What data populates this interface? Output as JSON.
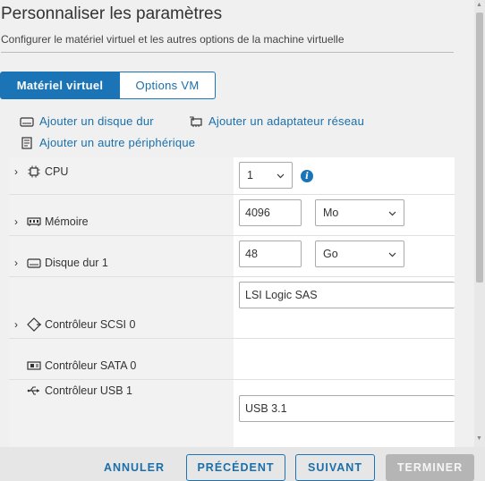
{
  "header": {
    "title": "Personnaliser les paramètres",
    "subtitle": "Configurer le matériel virtuel et les autres options de la machine virtuelle"
  },
  "tabs": [
    {
      "label": "Matériel virtuel",
      "active": true
    },
    {
      "label": "Options VM",
      "active": false
    }
  ],
  "actions": {
    "add_disk": "Ajouter un disque dur",
    "add_network": "Ajouter un adaptateur réseau",
    "add_device": "Ajouter un autre périphérique"
  },
  "hardware": {
    "cpu": {
      "label": "CPU",
      "value": "1"
    },
    "memory": {
      "label": "Mémoire",
      "value": "4096",
      "unit": "Mo"
    },
    "disk": {
      "label": "Disque dur 1",
      "value": "48",
      "unit": "Go"
    },
    "scsi": {
      "label": "Contrôleur SCSI 0",
      "value": "LSI Logic SAS"
    },
    "sata": {
      "label": "Contrôleur SATA 0"
    },
    "usb": {
      "label": "Contrôleur USB 1",
      "value": "USB 3.1"
    }
  },
  "footer": {
    "cancel": "ANNULER",
    "previous": "PRÉCÉDENT",
    "next": "SUIVANT",
    "finish": "TERMINER"
  },
  "colors": {
    "accent": "#1a74b6",
    "link": "#1a6faa",
    "disabled": "#b5b5b5"
  }
}
